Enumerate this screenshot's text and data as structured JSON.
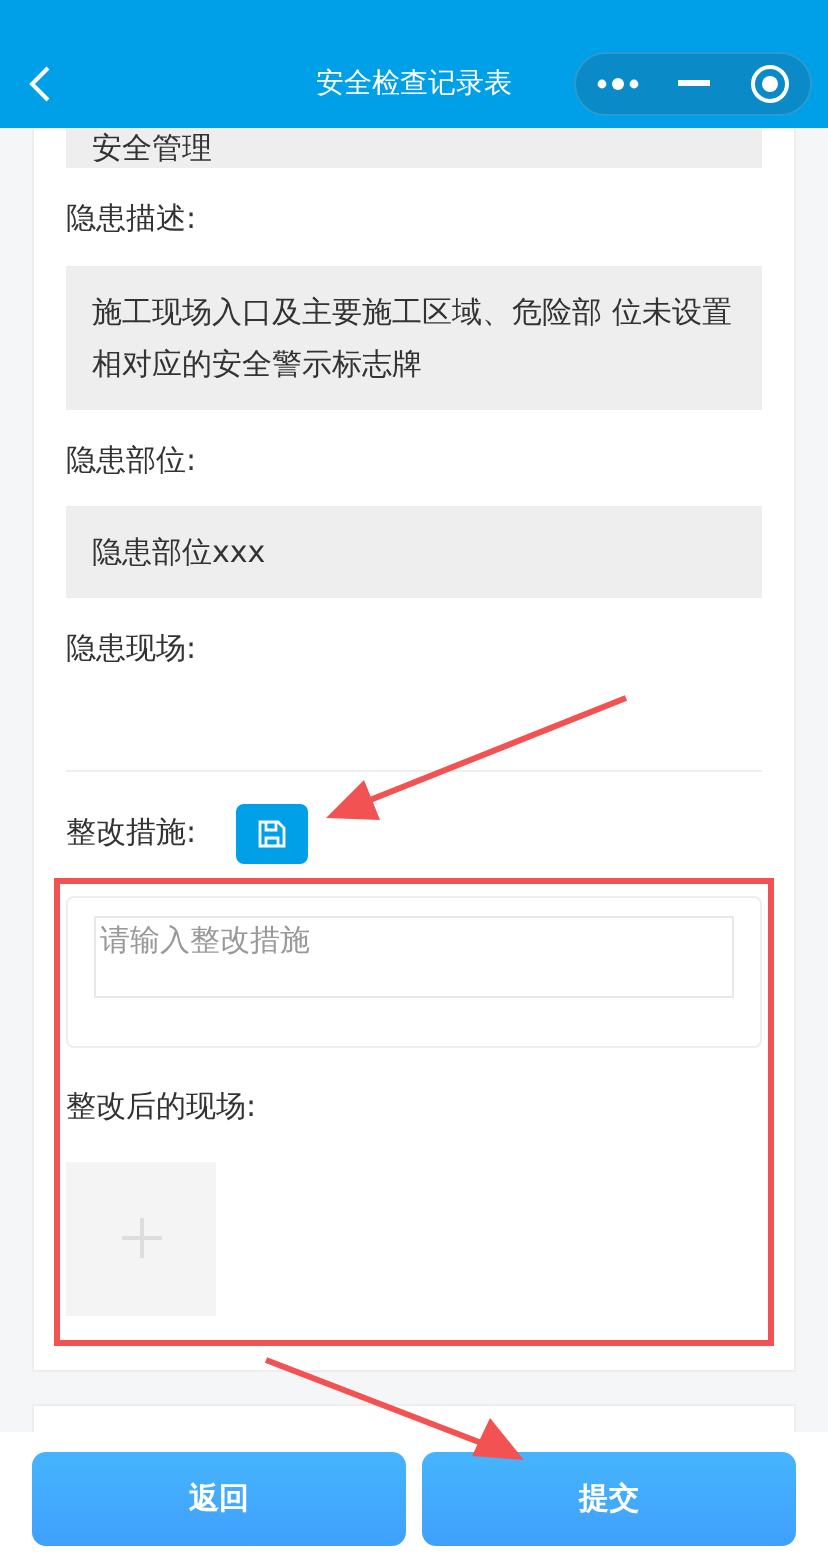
{
  "header": {
    "title": "安全检查记录表"
  },
  "fields": [
    {
      "value": "安全管理"
    },
    {
      "label": "隐患描述:",
      "value": "施工现场入口及主要施工区域、危险部 位未设置相对应的安全警示标志牌"
    },
    {
      "label": "隐患部位:",
      "value": "隐患部位xxx"
    },
    {
      "label": "隐患现场:"
    }
  ],
  "measures": {
    "label": "整改措施:",
    "placeholder": "请输入整改措施"
  },
  "after_scene": {
    "label": "整改后的现场:"
  },
  "buttons": [
    {
      "label": "返回"
    },
    {
      "label": "提交"
    }
  ]
}
